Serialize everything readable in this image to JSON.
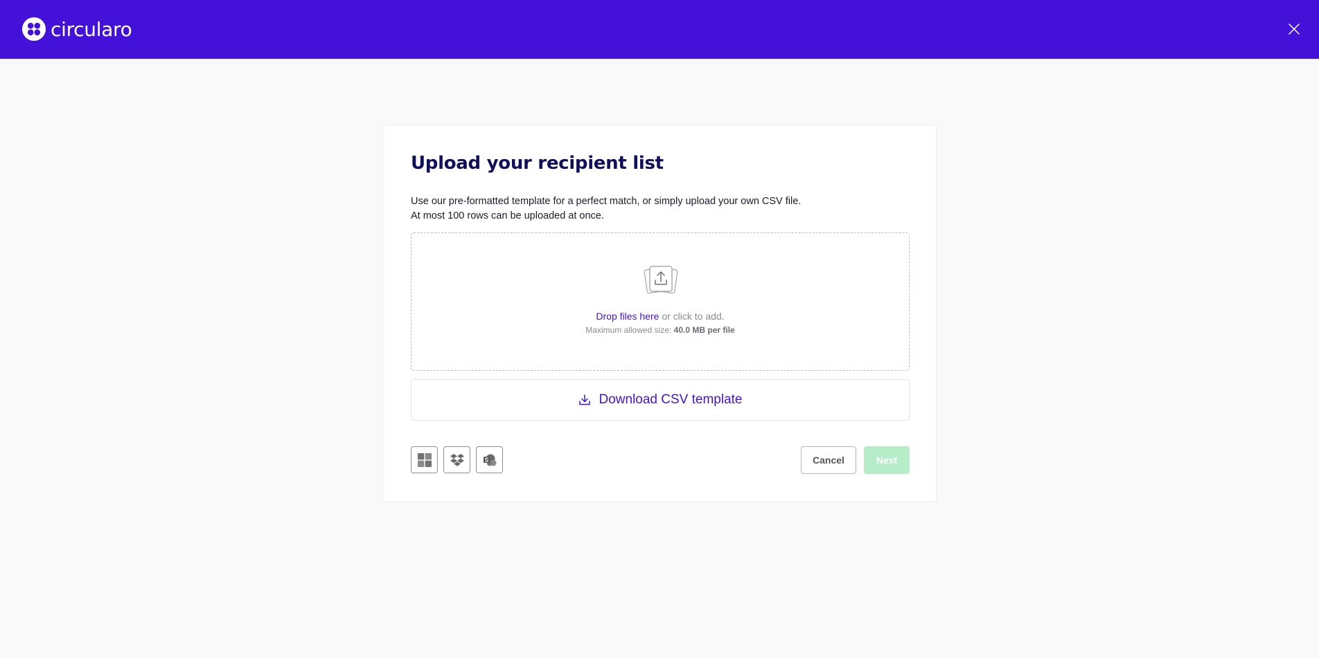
{
  "header": {
    "logo_text": "circularo",
    "background_color": "#4411d9",
    "close_icon": "close-icon"
  },
  "upload_card": {
    "title": "Upload your recipient list",
    "description_line1": "Use our pre-formatted template for a perfect match, or simply upload your own CSV file.",
    "description_line2": "At most 100 rows can be uploaded at once.",
    "dropzone": {
      "icon": "upload-files-icon",
      "link_text": "Drop files here",
      "rest_text": " or click to add.",
      "max_size_label": "Maximum allowed size: ",
      "max_size_value": "40.0 MB per file"
    },
    "download_template_label": "Download CSV template",
    "sources": [
      {
        "name": "microsoft-icon"
      },
      {
        "name": "dropbox-icon"
      },
      {
        "name": "sharepoint-icon"
      }
    ],
    "cancel_label": "Cancel",
    "next_label": "Next",
    "next_enabled": false,
    "accent_color": "#4411d9",
    "next_color": "#b7ecc8"
  }
}
